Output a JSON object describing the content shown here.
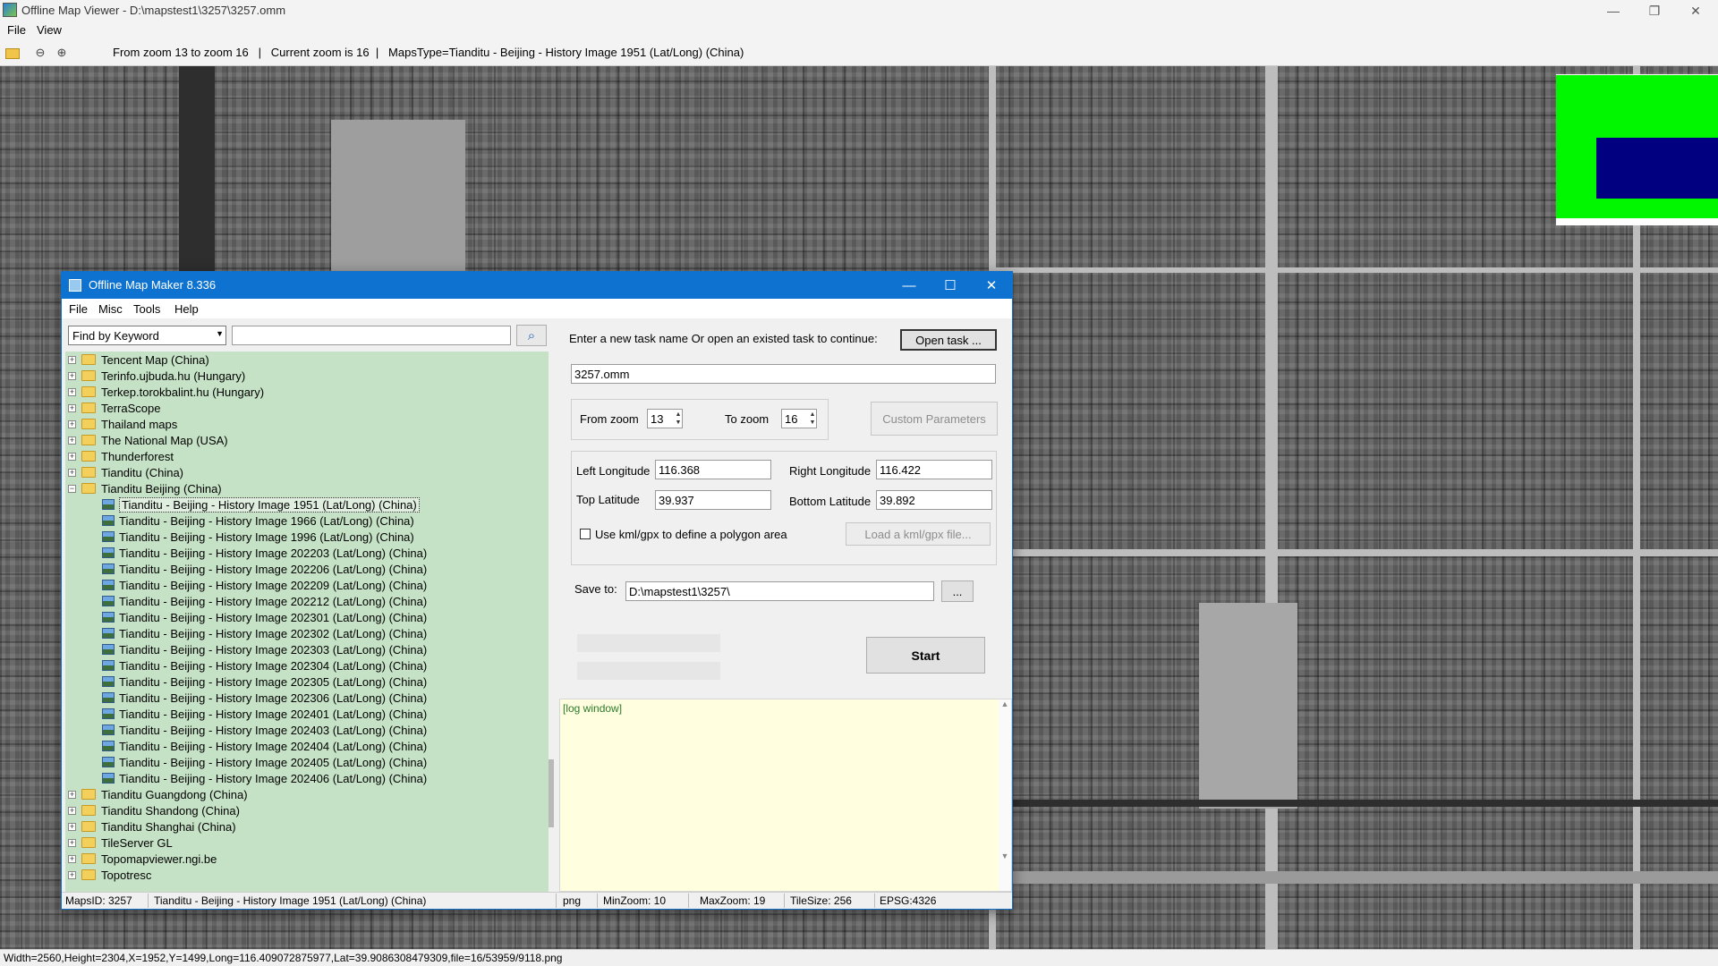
{
  "window": {
    "title": "Offline Map Viewer - D:\\mapstest1\\3257\\3257.omm",
    "controls": {
      "minimize": "—",
      "restore": "❐",
      "close": "✕"
    }
  },
  "menu": {
    "file": "File",
    "view": "View"
  },
  "toolbar": {
    "icons": [
      "open-folder-icon",
      "zoom-out-icon",
      "zoom-in-icon"
    ],
    "status": "From zoom 13 to zoom 16   |   Current zoom is 16  |   MapsType=Tianditu - Beijing - History Image 1951 (Lat/Long) (China)"
  },
  "overview": {
    "colors": {
      "background": "#00f700",
      "viewport": "#000080"
    }
  },
  "statusbar": {
    "text": "Width=2560,Height=2304,X=1952,Y=1499,Long=116.409072875977,Lat=39.9086308479309,file=16/53959/9118.png"
  },
  "dialog": {
    "title": "Offline Map Maker 8.336",
    "menu": {
      "file": "File",
      "misc": "Misc",
      "tools": "Tools",
      "help": "Help"
    },
    "find_mode": "Find by Keyword",
    "search_value": "",
    "tree": [
      {
        "label": "Tencent Map (China)",
        "type": "folder",
        "expanded": false
      },
      {
        "label": "Terinfo.ujbuda.hu (Hungary)",
        "type": "folder",
        "expanded": false
      },
      {
        "label": "Terkep.torokbalint.hu (Hungary)",
        "type": "folder",
        "expanded": false
      },
      {
        "label": "TerraScope",
        "type": "folder",
        "expanded": false
      },
      {
        "label": "Thailand maps",
        "type": "folder",
        "expanded": false
      },
      {
        "label": "The National Map (USA)",
        "type": "folder",
        "expanded": false
      },
      {
        "label": "Thunderforest",
        "type": "folder",
        "expanded": false
      },
      {
        "label": "Tianditu (China)",
        "type": "folder",
        "expanded": false
      },
      {
        "label": "Tianditu Beijing (China)",
        "type": "folder",
        "expanded": true
      },
      {
        "label": "Tianditu - Beijing - History Image 1951 (Lat/Long) (China)",
        "type": "map",
        "selected": true
      },
      {
        "label": "Tianditu - Beijing - History Image 1966 (Lat/Long) (China)",
        "type": "map"
      },
      {
        "label": "Tianditu - Beijing - History Image 1996 (Lat/Long) (China)",
        "type": "map"
      },
      {
        "label": "Tianditu - Beijing - History Image 202203 (Lat/Long) (China)",
        "type": "map"
      },
      {
        "label": "Tianditu - Beijing - History Image 202206 (Lat/Long) (China)",
        "type": "map"
      },
      {
        "label": "Tianditu - Beijing - History Image 202209 (Lat/Long) (China)",
        "type": "map"
      },
      {
        "label": "Tianditu - Beijing - History Image 202212 (Lat/Long) (China)",
        "type": "map"
      },
      {
        "label": "Tianditu - Beijing - History Image 202301 (Lat/Long) (China)",
        "type": "map"
      },
      {
        "label": "Tianditu - Beijing - History Image 202302 (Lat/Long) (China)",
        "type": "map"
      },
      {
        "label": "Tianditu - Beijing - History Image 202303 (Lat/Long) (China)",
        "type": "map"
      },
      {
        "label": "Tianditu - Beijing - History Image 202304 (Lat/Long) (China)",
        "type": "map"
      },
      {
        "label": "Tianditu - Beijing - History Image 202305 (Lat/Long) (China)",
        "type": "map"
      },
      {
        "label": "Tianditu - Beijing - History Image 202306 (Lat/Long) (China)",
        "type": "map"
      },
      {
        "label": "Tianditu - Beijing - History Image 202401 (Lat/Long) (China)",
        "type": "map"
      },
      {
        "label": "Tianditu - Beijing - History Image 202403 (Lat/Long) (China)",
        "type": "map"
      },
      {
        "label": "Tianditu - Beijing - History Image 202404 (Lat/Long) (China)",
        "type": "map"
      },
      {
        "label": "Tianditu - Beijing - History Image 202405 (Lat/Long) (China)",
        "type": "map"
      },
      {
        "label": "Tianditu - Beijing - History Image 202406 (Lat/Long) (China)",
        "type": "map"
      },
      {
        "label": "Tianditu Guangdong (China)",
        "type": "folder",
        "expanded": false
      },
      {
        "label": "Tianditu Shandong (China)",
        "type": "folder",
        "expanded": false
      },
      {
        "label": "Tianditu Shanghai (China)",
        "type": "folder",
        "expanded": false
      },
      {
        "label": "TileServer GL",
        "type": "folder",
        "expanded": false
      },
      {
        "label": "Topomapviewer.ngi.be",
        "type": "folder",
        "expanded": false
      },
      {
        "label": "Topotresc",
        "type": "folder",
        "expanded": false
      }
    ],
    "task_prompt": "Enter a new task name Or open an existed task to continue:",
    "open_task": "Open task ...",
    "task_name": "3257.omm",
    "from_zoom_label": "From zoom",
    "from_zoom": "13",
    "to_zoom_label": "To zoom",
    "to_zoom": "16",
    "custom_params": "Custom Parameters",
    "left_lon_label": "Left Longitude",
    "left_lon": "116.368",
    "right_lon_label": "Right Longitude",
    "right_lon": "116.422",
    "top_lat_label": "Top Latitude",
    "top_lat": "39.937",
    "bottom_lat_label": "Bottom Latitude",
    "bottom_lat": "39.892",
    "kml_label": "Use kml/gpx to define a polygon area",
    "kml_checked": false,
    "load_kml": "Load a kml/gpx file...",
    "save_to_label": "Save to:",
    "save_to": "D:\\mapstest1\\3257\\",
    "browse": "...",
    "start": "Start",
    "log": "[log window]",
    "status": {
      "maps_id": "MapsID: 3257",
      "map_name": "Tianditu - Beijing - History Image 1951 (Lat/Long) (China)",
      "format": "png",
      "min_zoom": "MinZoom: 10",
      "max_zoom": "MaxZoom: 19",
      "tile_size": "TileSize: 256",
      "epsg": "EPSG:4326"
    }
  }
}
